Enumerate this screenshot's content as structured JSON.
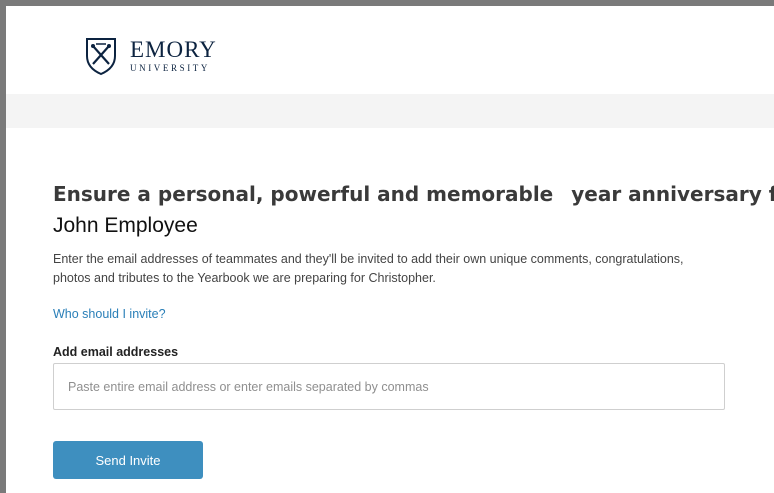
{
  "header": {
    "logo_name": "EMORY",
    "logo_subtitle": "UNIVERSITY"
  },
  "main": {
    "title_part1": "Ensure a personal, powerful and memorable",
    "title_part2": "year anniversary for",
    "recipient_name": "John Employee",
    "description": "Enter the email addresses of teammates and they'll be invited to add their own unique comments, congratulations, photos and tributes to the Yearbook we are preparing for Christopher.",
    "who_link": "Who should I invite?",
    "field_label": "Add email addresses",
    "email_placeholder": "Paste entire email address or enter emails separated by commas",
    "email_value": "",
    "send_button": "Send Invite"
  },
  "colors": {
    "brand_navy": "#0c2340",
    "link_blue": "#2a7fb8",
    "button_blue": "#3e8fbf"
  },
  "icons": {
    "logo": "emory-shield-icon"
  }
}
